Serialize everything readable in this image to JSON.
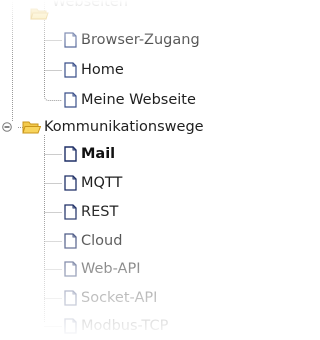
{
  "tree": {
    "groups": [
      {
        "label": "Webseiten",
        "expanded": true,
        "items": [
          {
            "label": "Browser-Zugang",
            "icon": "document-icon"
          },
          {
            "label": "Home",
            "icon": "document-icon"
          },
          {
            "label": "Meine Webseite",
            "icon": "document-icon"
          }
        ]
      },
      {
        "label": "Kommunikationswege",
        "expanded": true,
        "expander_symbol": "minus",
        "icon": "open-folder-icon",
        "items": [
          {
            "label": "Mail",
            "icon": "document-icon",
            "selected": true
          },
          {
            "label": "MQTT",
            "icon": "document-icon"
          },
          {
            "label": "REST",
            "icon": "document-icon"
          },
          {
            "label": "Cloud",
            "icon": "document-icon"
          },
          {
            "label": "Web-API",
            "icon": "document-icon"
          },
          {
            "label": "Socket-API",
            "icon": "document-icon"
          },
          {
            "label": "Modbus-TCP",
            "icon": "document-icon"
          }
        ]
      }
    ],
    "colors": {
      "folder": "#f2c94c",
      "folder_outline": "#d4a017",
      "doc_border": "#3a4f8a",
      "tree_line": "#9a9a9a",
      "text": "#1f1f1f"
    }
  }
}
